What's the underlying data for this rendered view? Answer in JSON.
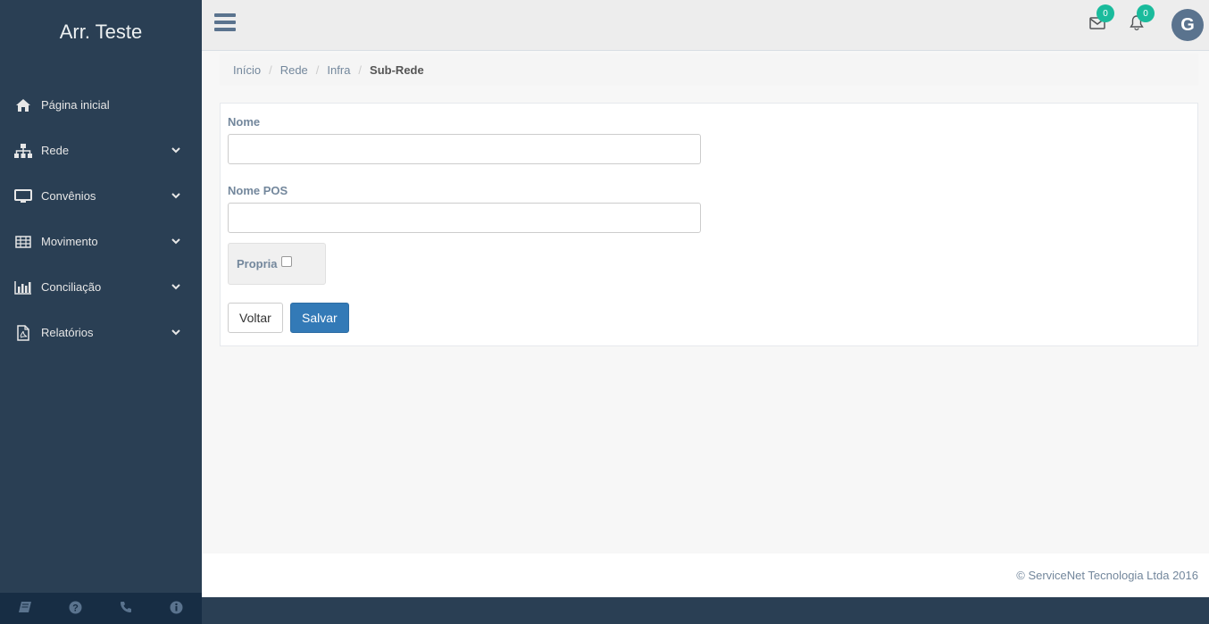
{
  "brand": {
    "title": "Arr. Teste"
  },
  "sidebar": {
    "items": [
      {
        "label": "Página inicial",
        "icon": "home-icon",
        "has_submenu": false
      },
      {
        "label": "Rede",
        "icon": "sitemap-icon",
        "has_submenu": true
      },
      {
        "label": "Convênios",
        "icon": "desktop-icon",
        "has_submenu": true
      },
      {
        "label": "Movimento",
        "icon": "table-icon",
        "has_submenu": true
      },
      {
        "label": "Conciliação",
        "icon": "bar-chart-icon",
        "has_submenu": true
      },
      {
        "label": "Relatórios",
        "icon": "pdf-file-icon",
        "has_submenu": true
      }
    ],
    "footer_icons": [
      "book-icon",
      "question-icon",
      "phone-icon",
      "info-icon"
    ]
  },
  "topnav": {
    "mail_count": "0",
    "notifications_count": "0",
    "avatar_initial": "G"
  },
  "breadcrumb": {
    "items": [
      "Início",
      "Rede",
      "Infra"
    ],
    "active": "Sub-Rede"
  },
  "form": {
    "nome_label": "Nome",
    "nome_value": "",
    "nome_pos_label": "Nome POS",
    "nome_pos_value": "",
    "propria_label": "Propria",
    "propria_checked": false,
    "back_label": "Voltar",
    "save_label": "Salvar"
  },
  "footer": {
    "copyright": "© ServiceNet Tecnologia Ltda 2016"
  },
  "colors": {
    "sidebar_bg": "#2a3f54",
    "accent_badge": "#1abb9c",
    "primary_button": "#337ab7",
    "avatar_bg": "#5a738e"
  }
}
